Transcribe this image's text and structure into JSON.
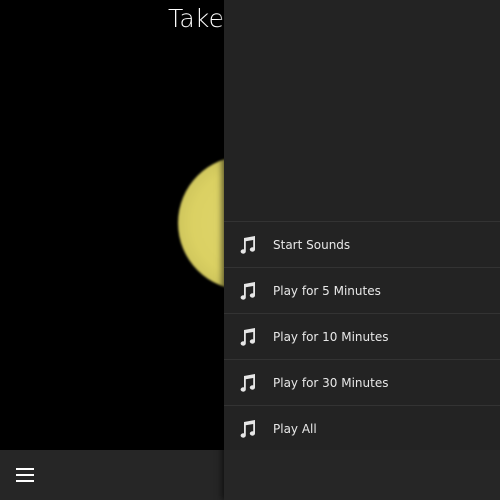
{
  "app": {
    "title_visible": "Take"
  },
  "menu_icon": "menu-icon",
  "drawer": {
    "items": [
      {
        "label": "Start Sounds",
        "icon": "music-note-icon"
      },
      {
        "label": "Play for 5 Minutes",
        "icon": "music-note-icon"
      },
      {
        "label": "Play for 10 Minutes",
        "icon": "music-note-icon"
      },
      {
        "label": "Play for 30 Minutes",
        "icon": "music-note-icon"
      },
      {
        "label": "Play All",
        "icon": "music-note-icon"
      }
    ]
  },
  "colors": {
    "background": "#000000",
    "drawer": "#232323",
    "bottom_bar": "#262626",
    "sun": "#dbd163",
    "text": "#e8e8e8"
  }
}
